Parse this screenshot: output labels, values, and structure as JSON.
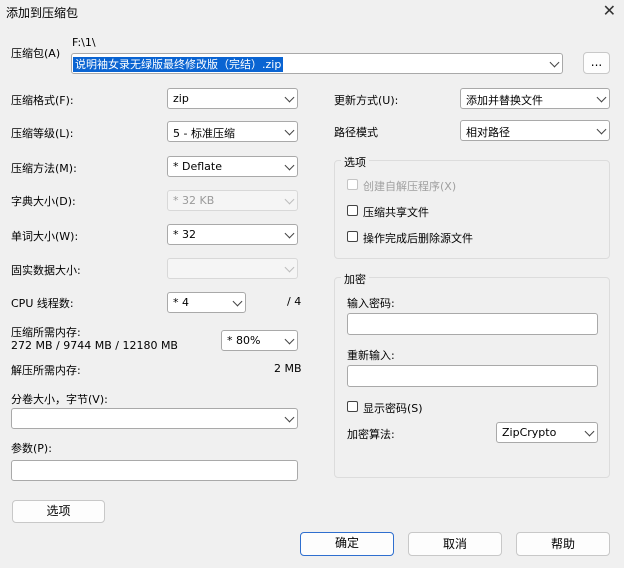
{
  "window": {
    "title": "添加到压缩包",
    "close_glyph": "✕"
  },
  "archive": {
    "label": "压缩包(A)",
    "path": "F:\\1\\",
    "filename": "说明袖女录无绿版最终修改版（完结）.zip",
    "browse_label": "..."
  },
  "left": {
    "format_label": "压缩格式(F):",
    "format_value": "zip",
    "level_label": "压缩等级(L):",
    "level_value": "5 - 标准压缩",
    "method_label": "压缩方法(M):",
    "method_value": "* Deflate",
    "dict_label": "字典大小(D):",
    "dict_value": "* 32 KB",
    "word_label": "单词大小(W):",
    "word_value": "* 32",
    "solid_label": "固实数据大小:",
    "solid_value": "",
    "cpu_label": "CPU 线程数:",
    "cpu_value": "* 4",
    "cpu_total": "/ 4",
    "mem_label": "压缩所需内存:",
    "mem_detail": "272 MB / 9744 MB / 12180 MB",
    "mem_percent": "* 80%",
    "decomp_label": "解压所需内存:",
    "decomp_value": "2 MB",
    "volume_label": "分卷大小，字节(V):",
    "volume_value": "",
    "params_label": "参数(P):",
    "params_value": "",
    "options_button": "选项"
  },
  "right": {
    "update_label": "更新方式(U):",
    "update_value": "添加并替换文件",
    "path_label": "路径模式",
    "path_value": "相对路径",
    "options_title": "选项",
    "opt_sfx": "创建自解压程序(X)",
    "opt_shared": "压缩共享文件",
    "opt_delete": "操作完成后删除源文件",
    "enc_title": "加密",
    "pwd_label": "输入密码:",
    "pwd2_label": "重新输入:",
    "show_pwd": "显示密码(S)",
    "enc_method_label": "加密算法:",
    "enc_method_value": "ZipCrypto"
  },
  "buttons": {
    "ok": "确定",
    "cancel": "取消",
    "help": "帮助"
  }
}
